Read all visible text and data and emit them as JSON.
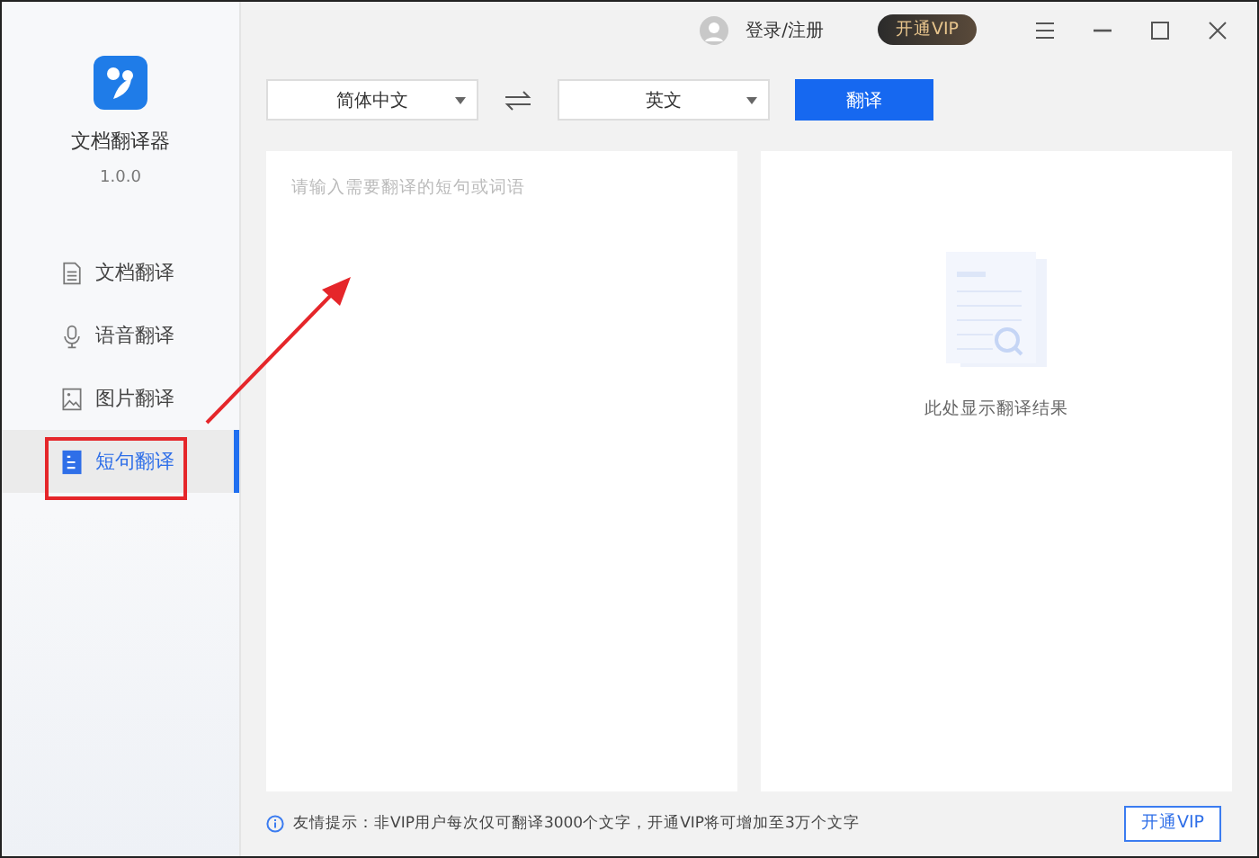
{
  "app": {
    "name": "文档翻译器",
    "version": "1.0.0"
  },
  "sidebar": {
    "items": [
      {
        "label": "文档翻译",
        "kind": "document",
        "selected": false
      },
      {
        "label": "语音翻译",
        "kind": "voice",
        "selected": false
      },
      {
        "label": "图片翻译",
        "kind": "image",
        "selected": false
      },
      {
        "label": "短句翻译",
        "kind": "sentence",
        "selected": true
      }
    ]
  },
  "header": {
    "login": "登录/注册",
    "vip_button": "开通VIP"
  },
  "toolbar": {
    "source_language": "简体中文",
    "target_language": "英文",
    "translate_button": "翻译"
  },
  "input": {
    "placeholder": "请输入需要翻译的短句或词语"
  },
  "output": {
    "empty_text": "此处显示翻译结果"
  },
  "footer": {
    "tip": "友情提示：非VIP用户每次仅可翻译3000个文字，开通VIP将可增加至3万个文字",
    "vip_button": "开通VIP"
  }
}
